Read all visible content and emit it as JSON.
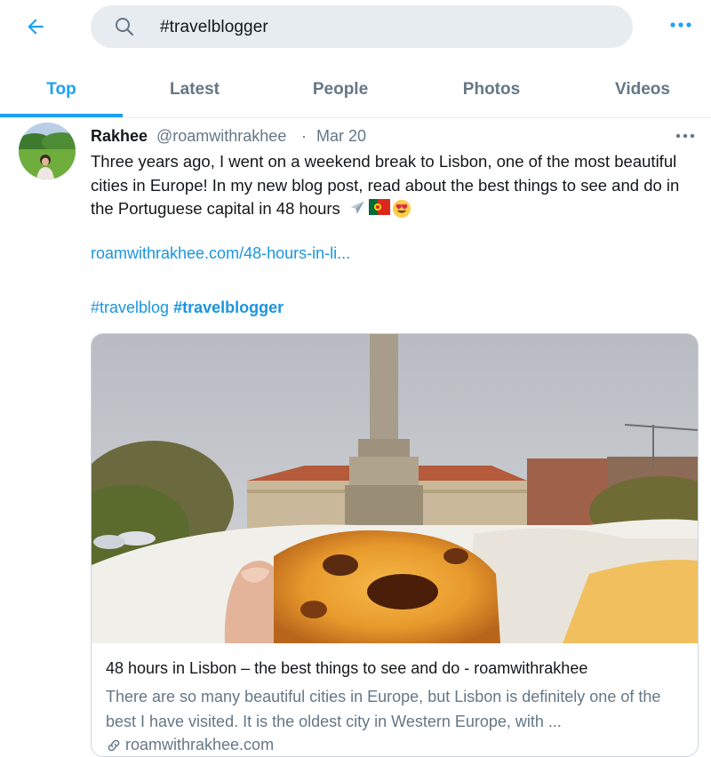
{
  "search": {
    "query": "#travelblogger"
  },
  "tabs": [
    {
      "label": "Top",
      "active": true
    },
    {
      "label": "Latest"
    },
    {
      "label": "People"
    },
    {
      "label": "Photos"
    },
    {
      "label": "Videos"
    }
  ],
  "tweet": {
    "display_name": "Rakhee",
    "handle": "@roamwithrakhee",
    "separator": "·",
    "date": "Mar 20",
    "text": "Three years ago, I went on a weekend break to Lisbon, one of the most beautiful cities in Europe! In my new blog post, read about the best things to see and do in the Portuguese capital in 48 hours",
    "emojis": [
      "airplane-emoji",
      "portugal-flag-emoji",
      "heart-eyes-emoji"
    ],
    "link": "roamwithrakhee.com/48-hours-in-li...",
    "hashtags": [
      "#travelblog",
      "#travelblogger"
    ],
    "card": {
      "title": "48 hours in Lisbon – the best things to see and do - roamwithrakhee",
      "description": "There are so many beautiful cities in Europe, but Lisbon is definitely one of the best I have visited. It is the oldest city in Western Europe, with ...",
      "domain": "roamwithrakhee.com"
    }
  },
  "colors": {
    "accent": "#1da1f2",
    "link": "#1b95e0",
    "muted": "#657786",
    "search_bg": "#e6ecf0"
  },
  "icons": [
    "back-arrow-icon",
    "search-icon",
    "more-options-icon",
    "link-icon"
  ]
}
